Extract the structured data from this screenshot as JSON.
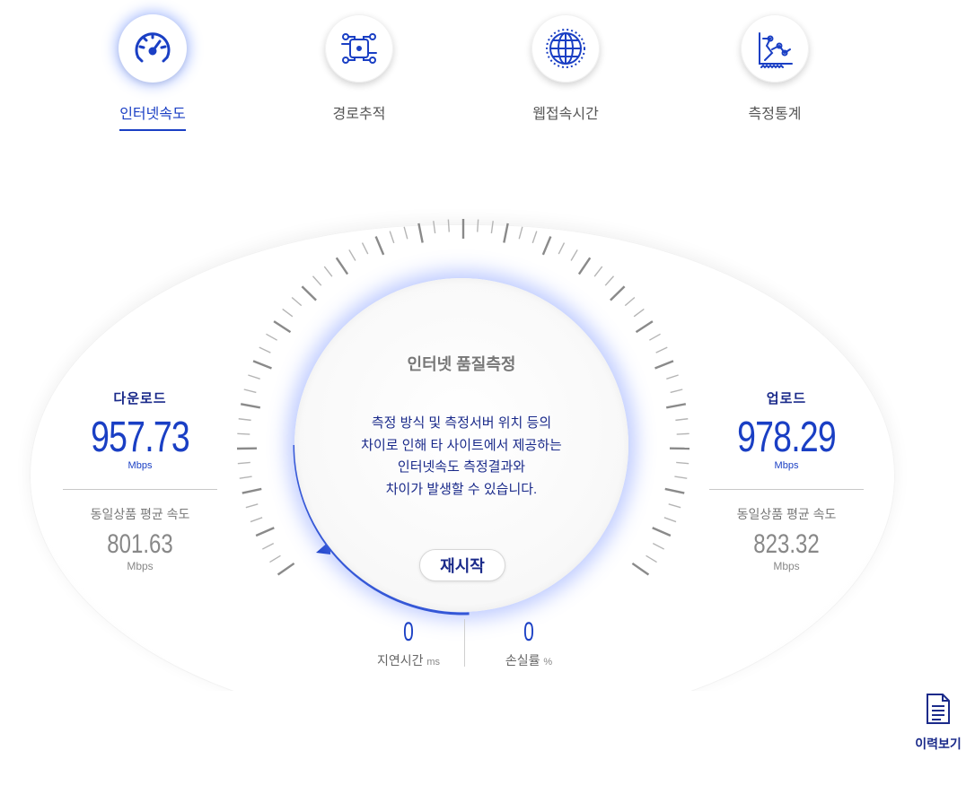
{
  "nav": {
    "items": [
      {
        "label": "인터넷속도",
        "icon": "speedometer-icon",
        "active": true
      },
      {
        "label": "경로추적",
        "icon": "route-trace-icon",
        "active": false
      },
      {
        "label": "웹접속시간",
        "icon": "globe-icon",
        "active": false
      },
      {
        "label": "측정통계",
        "icon": "statistics-icon",
        "active": false
      }
    ]
  },
  "download": {
    "title": "다운로드",
    "value": "957.73",
    "unit": "Mbps",
    "avg_title": "동일상품 평균 속도",
    "avg_value": "801.63",
    "avg_unit": "Mbps"
  },
  "upload": {
    "title": "업로드",
    "value": "978.29",
    "unit": "Mbps",
    "avg_title": "동일상품 평균 속도",
    "avg_value": "823.32",
    "avg_unit": "Mbps"
  },
  "gauge": {
    "title": "인터넷 품질측정",
    "note_lines": [
      "측정 방식 및 측정서버 위치 등의",
      "차이로 인해 타 사이트에서 제공하는",
      "인터넷속도 측정결과와",
      "차이가 발생할 수 있습니다."
    ],
    "restart_label": "재시작",
    "accent": "#1a3fc4"
  },
  "latency": {
    "value": "0",
    "label": "지연시간",
    "unit": "ms"
  },
  "loss": {
    "value": "0",
    "label": "손실률",
    "unit": "%"
  },
  "history": {
    "label": "이력보기",
    "icon": "document-icon"
  },
  "colors": {
    "primary": "#1a3fc4",
    "dark_blue": "#1a2a8a",
    "glow": "#6e8cff",
    "gray_text": "#777777"
  }
}
